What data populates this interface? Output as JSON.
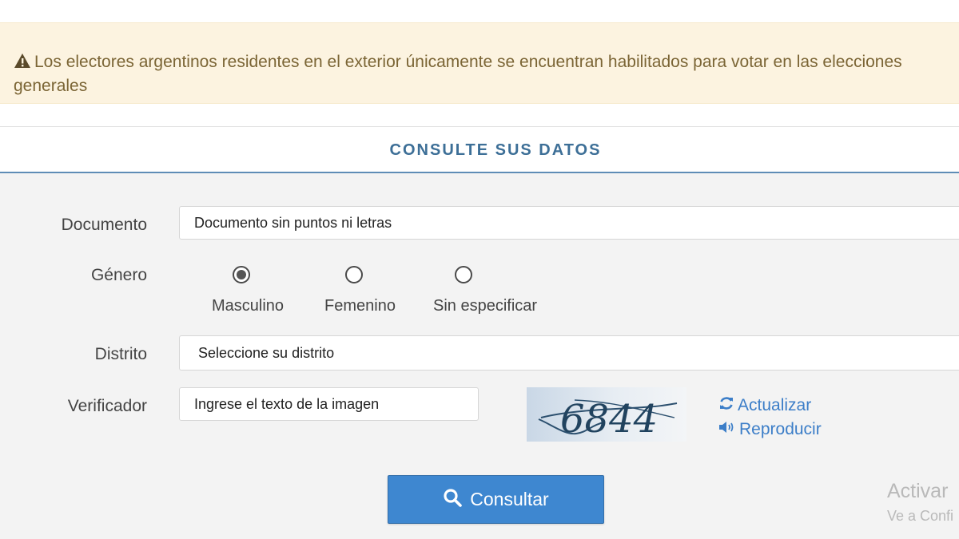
{
  "alert": {
    "icon": "warning-icon",
    "text": "Los electores argentinos residentes en el exterior únicamente se encuentran habilitados para votar en las elecciones generales"
  },
  "panel": {
    "title": "CONSULTE SUS DATOS"
  },
  "form": {
    "documento": {
      "label": "Documento",
      "placeholder": "Documento sin puntos ni letras"
    },
    "genero": {
      "label": "Género",
      "options": [
        {
          "label": "Masculino",
          "checked": true
        },
        {
          "label": "Femenino",
          "checked": false
        },
        {
          "label": "Sin especificar",
          "checked": false
        }
      ]
    },
    "distrito": {
      "label": "Distrito",
      "selected": "Seleccione su distrito"
    },
    "verificador": {
      "label": "Verificador",
      "placeholder": "Ingrese el texto de la imagen",
      "captcha_text": "6844",
      "refresh_label": "Actualizar",
      "play_label": "Reproducir"
    },
    "submit_label": "Consultar"
  },
  "watermark": {
    "line1": "Activar",
    "line2": "Ve a Confi"
  },
  "colors": {
    "alert_bg": "#fcf3e0",
    "alert_text": "#7b6535",
    "title": "#3d6f97",
    "button": "#3e87d0",
    "link": "#3c7ec8"
  }
}
